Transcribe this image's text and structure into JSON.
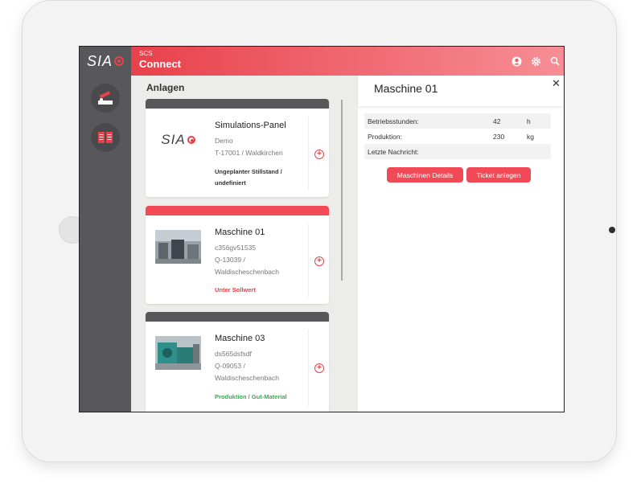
{
  "header": {
    "sub": "SCS",
    "title": "Connect"
  },
  "logo": {
    "text": "SIA"
  },
  "icons": {
    "user": "user-icon",
    "settings": "gear-icon",
    "search": "search-icon"
  },
  "sidebar": {
    "items": [
      {
        "icon": "machine-arm-icon"
      },
      {
        "icon": "book-icon"
      }
    ]
  },
  "list": {
    "title": "Anlagen",
    "cards": [
      {
        "name": "Simulations-Panel",
        "l1": "Demo",
        "l2": "T-17001 / Waldkirchen",
        "l3": "",
        "status": "Ungeplanter Stillstand /",
        "status2": "undefiniert",
        "status_color": "#333333",
        "bar": "dark"
      },
      {
        "name": "Maschine 01",
        "l1": "c356gv51535",
        "l2": "Q-13039 /",
        "l3": "Waldischeschenbach",
        "status": "Unter Sollwert",
        "status2": "",
        "status_color": "#e8414b",
        "bar": "red"
      },
      {
        "name": "Maschine 03",
        "l1": "ds565dsfsdf",
        "l2": "Q-09053 /",
        "l3": "Waldischeschenbach",
        "status": "Produktion / Gut-Material",
        "status2": "",
        "status_color": "#3aa856",
        "bar": "dark"
      }
    ]
  },
  "detail": {
    "title": "Maschine 01",
    "rows": [
      {
        "label": "Betriebsstunden:",
        "value": "42",
        "unit": "h"
      },
      {
        "label": "Produktion:",
        "value": "230",
        "unit": "kg"
      },
      {
        "label": "Letzte Nachricht:",
        "value": "",
        "unit": ""
      }
    ],
    "btn_details": "Maschinen Details",
    "btn_ticket": "Ticket anlegen"
  },
  "colors": {
    "accent": "#e8414b",
    "sidebar": "#58585a"
  }
}
